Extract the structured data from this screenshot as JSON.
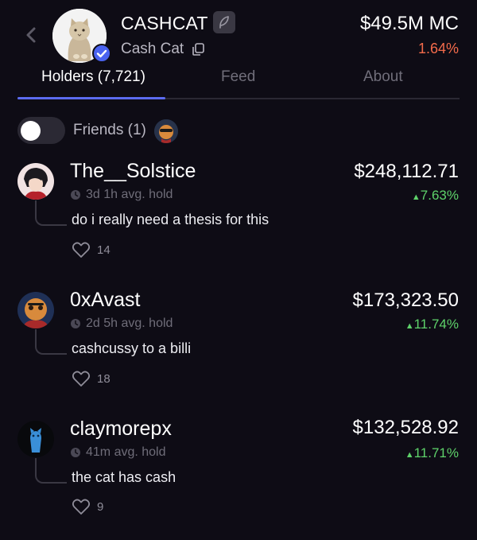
{
  "header": {
    "ticker": "CASHCAT",
    "name": "Cash Cat",
    "market_cap": "$49.5M MC",
    "change": "1.64%",
    "icons": [
      "back-arrow-icon",
      "feather-icon",
      "copy-icon",
      "verified-badge-icon"
    ]
  },
  "tabs": [
    {
      "label": "Holders (7,721)",
      "active": true
    },
    {
      "label": "Feed",
      "active": false
    },
    {
      "label": "About",
      "active": false
    }
  ],
  "friends": {
    "label": "Friends (1)",
    "toggle_on": false
  },
  "holders": [
    {
      "name": "The__Solstice",
      "value": "$248,112.71",
      "hold": "3d 1h avg. hold",
      "change": "7.63%",
      "comment": "do i really need a thesis for this",
      "likes": "14"
    },
    {
      "name": "0xAvast",
      "value": "$173,323.50",
      "hold": "2d 5h avg. hold",
      "change": "11.74%",
      "comment": "cashcussy to a billi",
      "likes": "18"
    },
    {
      "name": "claymorepx",
      "value": "$132,528.92",
      "hold": "41m avg. hold",
      "change": "11.71%",
      "comment": "the cat has cash",
      "likes": "9"
    }
  ],
  "colors": {
    "background": "#0e0c15",
    "accent": "#5b6bf0",
    "positive": "#5ed26a",
    "negative": "#f36b4b"
  }
}
